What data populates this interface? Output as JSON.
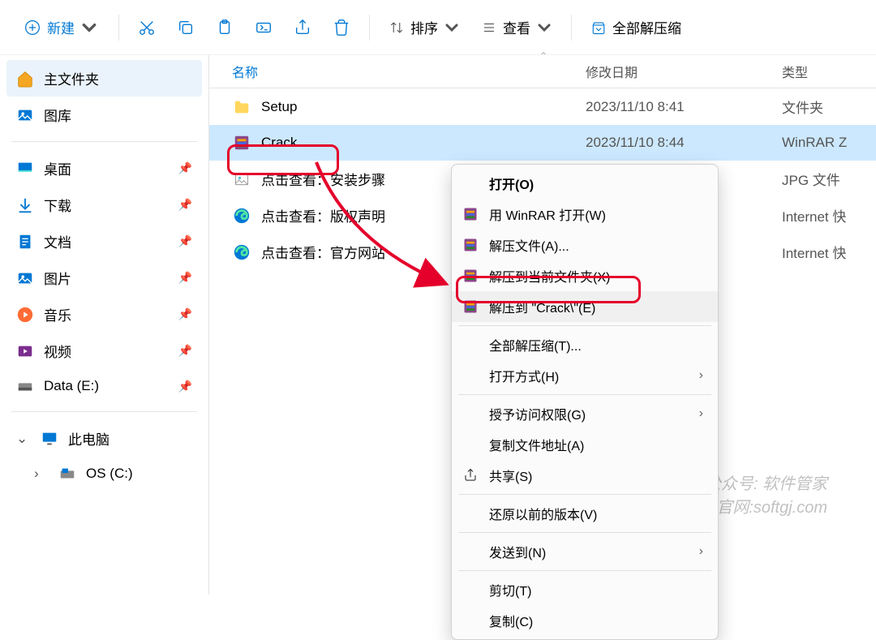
{
  "toolbar": {
    "new_label": "新建",
    "sort_label": "排序",
    "view_label": "查看",
    "extract_all_label": "全部解压缩"
  },
  "sidebar": {
    "home_label": "主文件夹",
    "gallery_label": "图库",
    "desktop_label": "桌面",
    "downloads_label": "下载",
    "documents_label": "文档",
    "pictures_label": "图片",
    "music_label": "音乐",
    "videos_label": "视频",
    "data_e_label": "Data (E:)",
    "this_pc_label": "此电脑",
    "os_c_label": "OS (C:)"
  },
  "columns": {
    "name": "名称",
    "date": "修改日期",
    "type": "类型"
  },
  "files": [
    {
      "name": "Setup",
      "date": "2023/11/10 8:41",
      "type": "文件夹",
      "icon": "folder"
    },
    {
      "name": "Crack",
      "date": "2023/11/10 8:44",
      "type": "WinRAR Z",
      "icon": "winrar"
    },
    {
      "name": "点击查看：安装步骤",
      "date": "",
      "type": "JPG 文件",
      "icon": "jpg"
    },
    {
      "name": "点击查看：版权声明",
      "date": "",
      "type": "Internet 快",
      "icon": "edge"
    },
    {
      "name": "点击查看：官方网站",
      "date": "",
      "type": "Internet 快",
      "icon": "edge"
    }
  ],
  "context_menu": {
    "open": "打开(O)",
    "open_winrar": "用 WinRAR 打开(W)",
    "extract_files": "解压文件(A)...",
    "extract_here": "解压到当前文件夹(X)",
    "extract_to": "解压到 \"Crack\\\"(E)",
    "extract_all": "全部解压缩(T)...",
    "open_with": "打开方式(H)",
    "grant_access": "授予访问权限(G)",
    "copy_path": "复制文件地址(A)",
    "share": "共享(S)",
    "restore": "还原以前的版本(V)",
    "send_to": "发送到(N)",
    "cut": "剪切(T)",
    "copy": "复制(C)"
  },
  "watermark": {
    "line1": "微信公众号: 软件管家",
    "line2": "官网:softgj.com"
  }
}
